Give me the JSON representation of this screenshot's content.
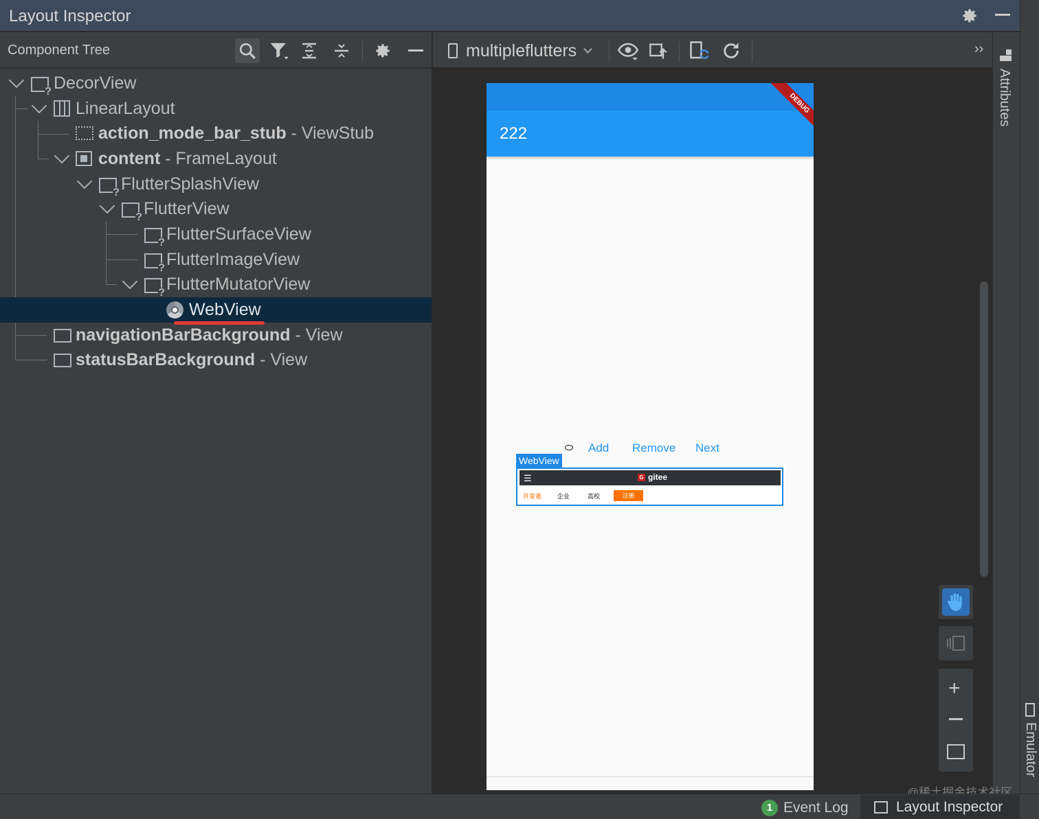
{
  "window": {
    "title": "Layout Inspector"
  },
  "toolbar": {
    "component_tree_label": "Component Tree",
    "process_label": "multipleflutters"
  },
  "tree": {
    "rows": [
      {
        "name": "DecorView",
        "type": ""
      },
      {
        "name": "LinearLayout",
        "type": ""
      },
      {
        "name": "action_mode_bar_stub",
        "sep": " - ",
        "type": "ViewStub"
      },
      {
        "name": "content",
        "sep": " - ",
        "type": "FrameLayout"
      },
      {
        "name": "FlutterSplashView",
        "type": ""
      },
      {
        "name": "FlutterView",
        "type": ""
      },
      {
        "name": "FlutterSurfaceView",
        "type": ""
      },
      {
        "name": "FlutterImageView",
        "type": ""
      },
      {
        "name": "FlutterMutatorView",
        "type": ""
      },
      {
        "name": "WebView",
        "type": ""
      },
      {
        "name": "navigationBarBackground",
        "sep": " - ",
        "type": "View"
      },
      {
        "name": "statusBarBackground",
        "sep": " - ",
        "type": "View"
      }
    ]
  },
  "device": {
    "debug_banner": "DEBUG",
    "appbar_title": "222",
    "buttons": {
      "add": "Add",
      "remove": "Remove",
      "next": "Next"
    },
    "webview_tag": "WebView",
    "webview": {
      "brand": "gitee",
      "nav": [
        "开发者",
        "企业",
        "高校"
      ],
      "signup": "注册"
    }
  },
  "right_panel": {
    "attributes": "Attributes",
    "emulator": "Emulator"
  },
  "status": {
    "event_log_count": "1",
    "event_log": "Event Log",
    "layout_inspector": "Layout Inspector",
    "watermark": "@稀土掘金技术社区"
  },
  "colors": {
    "accent": "#2196f3",
    "selection": "#0d293e",
    "underline": "#e53935",
    "hand_button": "#2f6fb5"
  }
}
